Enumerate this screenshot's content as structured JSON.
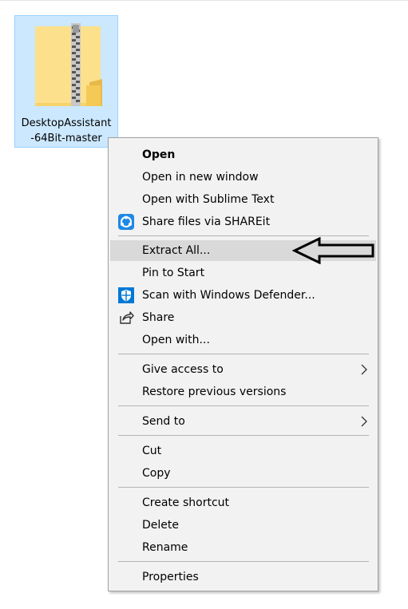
{
  "desktop": {
    "file": {
      "name_line1": "DesktopAssistant",
      "name_line2": "-64Bit-master",
      "icon": "zip-folder-icon"
    }
  },
  "context_menu": {
    "items": [
      {
        "label": "Open",
        "bold": true
      },
      {
        "label": "Open in new window"
      },
      {
        "label": "Open with Sublime Text"
      },
      {
        "label": "Share files via SHAREit",
        "icon": "shareit-icon"
      },
      {
        "label": "Extract All...",
        "highlighted": true
      },
      {
        "label": "Pin to Start"
      },
      {
        "label": "Scan with Windows Defender...",
        "icon": "windows-defender-icon"
      },
      {
        "label": "Share",
        "icon": "share-icon"
      },
      {
        "label": "Open with..."
      },
      {
        "label": "Give access to",
        "submenu": true
      },
      {
        "label": "Restore previous versions"
      },
      {
        "label": "Send to",
        "submenu": true
      },
      {
        "label": "Cut"
      },
      {
        "label": "Copy"
      },
      {
        "label": "Create shortcut"
      },
      {
        "label": "Delete"
      },
      {
        "label": "Rename"
      },
      {
        "label": "Properties"
      }
    ]
  },
  "annotation": {
    "icon": "pointer-arrow-icon",
    "points_to": "Extract All..."
  },
  "colors": {
    "selection_fill": "#cce8ff",
    "selection_border": "#99d1ff",
    "menu_bg": "#f2f2f2",
    "menu_highlight": "#d9d9d9",
    "shareit_blue": "#1e88e5",
    "defender_blue": "#0078d7"
  }
}
